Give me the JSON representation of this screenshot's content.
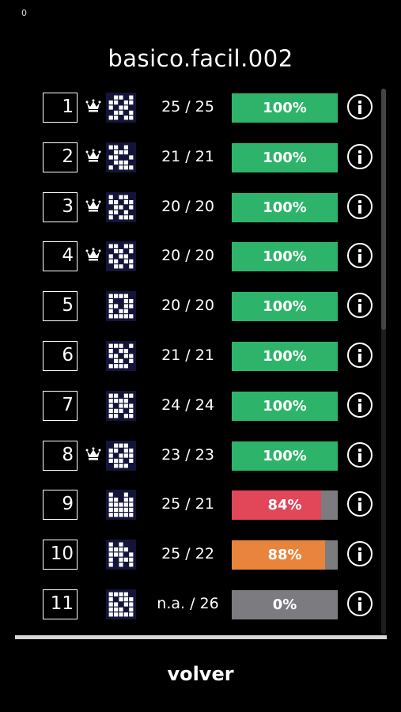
{
  "status_corner": "0",
  "title": "basico.facil.002",
  "back_label": "volver",
  "colors": {
    "green": "#2eb46a",
    "red": "#e24659",
    "orange": "#e8843c",
    "gray": "#7b7b80"
  },
  "levels": [
    {
      "number": "1",
      "crown": true,
      "score": "25 / 25",
      "percent_label": "100%",
      "percent": 100,
      "color": "green"
    },
    {
      "number": "2",
      "crown": true,
      "score": "21 / 21",
      "percent_label": "100%",
      "percent": 100,
      "color": "green"
    },
    {
      "number": "3",
      "crown": true,
      "score": "20 / 20",
      "percent_label": "100%",
      "percent": 100,
      "color": "green"
    },
    {
      "number": "4",
      "crown": true,
      "score": "20 / 20",
      "percent_label": "100%",
      "percent": 100,
      "color": "green"
    },
    {
      "number": "5",
      "crown": false,
      "score": "20 / 20",
      "percent_label": "100%",
      "percent": 100,
      "color": "green"
    },
    {
      "number": "6",
      "crown": false,
      "score": "21 / 21",
      "percent_label": "100%",
      "percent": 100,
      "color": "green"
    },
    {
      "number": "7",
      "crown": false,
      "score": "24 / 24",
      "percent_label": "100%",
      "percent": 100,
      "color": "green"
    },
    {
      "number": "8",
      "crown": true,
      "score": "23 / 23",
      "percent_label": "100%",
      "percent": 100,
      "color": "green"
    },
    {
      "number": "9",
      "crown": false,
      "score": "25 / 21",
      "percent_label": "84%",
      "percent": 84,
      "color": "red"
    },
    {
      "number": "10",
      "crown": false,
      "score": "25 / 22",
      "percent_label": "88%",
      "percent": 88,
      "color": "orange"
    },
    {
      "number": "11",
      "crown": false,
      "score": "n.a. / 26",
      "percent_label": "0%",
      "percent": 0,
      "color": "gray"
    }
  ]
}
